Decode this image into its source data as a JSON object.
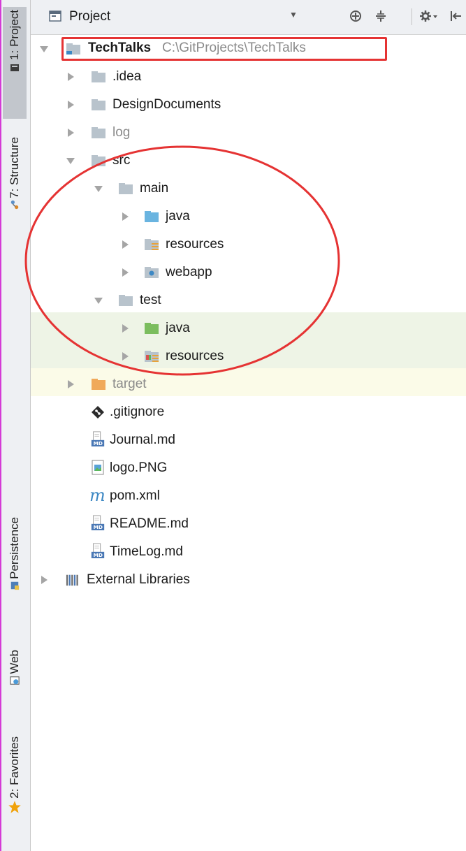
{
  "tool_windows": {
    "project": "1: Project",
    "structure": "7: Structure",
    "persistence": "Persistence",
    "web": "Web",
    "favorites": "2: Favorites"
  },
  "toolbar": {
    "title": "Project"
  },
  "tree": {
    "root": {
      "name": "TechTalks",
      "path": "C:\\GitProjects\\TechTalks"
    },
    "idea": ".idea",
    "design_documents": "DesignDocuments",
    "log": "log",
    "src": "src",
    "main": "main",
    "main_java": "java",
    "main_resources": "resources",
    "webapp": "webapp",
    "test": "test",
    "test_java": "java",
    "test_resources": "resources",
    "target": "target",
    "gitignore": ".gitignore",
    "journal": "Journal.md",
    "logo": "logo.PNG",
    "pom": "pom.xml",
    "readme": "README.md",
    "timelog": "TimeLog.md",
    "external_libraries": "External Libraries"
  },
  "colors": {
    "folder_gray": "#b8c3cc",
    "folder_blue": "#6ab4e0",
    "folder_green": "#7bbd5e",
    "folder_orange": "#f0a95a",
    "annotation_red": "#e53333"
  }
}
